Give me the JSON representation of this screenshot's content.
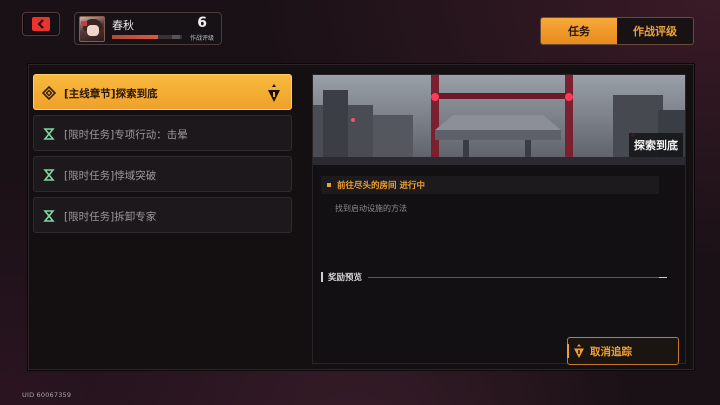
{
  "header": {
    "back_icon": "chevron-left-icon",
    "profile": {
      "name": "春秋",
      "level": "6",
      "rank_label": "作战评级",
      "exp_fraction": 0.65
    },
    "tabs": [
      {
        "label": "任务",
        "active": true
      },
      {
        "label": "作战评级",
        "active": false
      }
    ]
  },
  "quests": [
    {
      "label": "[主线章节]探索到底",
      "active": true,
      "icon": "main-quest-diamond-icon"
    },
    {
      "label": "[限时任务]专项行动：击晕",
      "active": false,
      "icon": "limited-quest-icon"
    },
    {
      "label": "[限时任务]悖域突破",
      "active": false,
      "icon": "limited-quest-icon"
    },
    {
      "label": "[限时任务]拆卸专家",
      "active": false,
      "icon": "limited-quest-icon"
    }
  ],
  "detail": {
    "scene_title": "探索到底",
    "objective": "前往尽头的房间  进行中",
    "description": "找到启动设施的方法",
    "reward_heading": "奖励预览",
    "untrack_label": "取消追踪",
    "untrack_icon": "track-marker-icon"
  },
  "footer": {
    "uid": "UID 60067359"
  },
  "colors": {
    "accent": "#f0a030",
    "back_red": "#e8342c",
    "limited_icon": "#7fd6a0"
  }
}
